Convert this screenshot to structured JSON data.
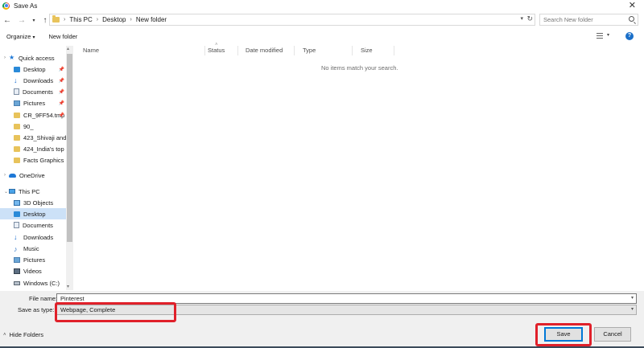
{
  "window": {
    "title": "Save As",
    "close_glyph": "✕"
  },
  "address_bar": {
    "crumbs": [
      "This PC",
      "Desktop",
      "New folder"
    ],
    "search_placeholder": "Search New folder"
  },
  "command_bar": {
    "organize": "Organize",
    "new_folder": "New folder"
  },
  "nav_pane": {
    "quick_access": "Quick access",
    "items": [
      {
        "label": "Quick access",
        "icon": "star-icon"
      },
      {
        "label": "Desktop",
        "icon": "desktop-icon",
        "pinned": true
      },
      {
        "label": "Downloads",
        "icon": "downloads-icon",
        "pinned": true
      },
      {
        "label": "Documents",
        "icon": "documents-icon",
        "pinned": true
      },
      {
        "label": "Pictures",
        "icon": "pictures-icon",
        "pinned": true
      },
      {
        "label": "CR_9FF54.tmp",
        "icon": "folder-icon",
        "pinned": true
      },
      {
        "label": "90_",
        "icon": "folder-icon"
      },
      {
        "label": "423_Shivaji and A",
        "icon": "folder-icon"
      },
      {
        "label": "424_India's top E",
        "icon": "folder-icon"
      },
      {
        "label": "Facts Graphics",
        "icon": "folder-icon"
      },
      {
        "label": "OneDrive",
        "icon": "onedrive-icon"
      },
      {
        "label": "This PC",
        "icon": "this-pc-icon"
      },
      {
        "label": "3D Objects",
        "icon": "3d-objects-icon"
      },
      {
        "label": "Desktop",
        "icon": "desktop-icon",
        "selected": true
      },
      {
        "label": "Documents",
        "icon": "documents-icon"
      },
      {
        "label": "Downloads",
        "icon": "downloads-icon"
      },
      {
        "label": "Music",
        "icon": "music-icon"
      },
      {
        "label": "Pictures",
        "icon": "pictures-icon"
      },
      {
        "label": "Videos",
        "icon": "videos-icon"
      },
      {
        "label": "Windows (C:)",
        "icon": "drive-icon"
      }
    ]
  },
  "file_list": {
    "columns": [
      "Name",
      "Status",
      "Date modified",
      "Type",
      "Size"
    ],
    "empty_message": "No items match your search."
  },
  "form": {
    "file_name_label": "File name:",
    "file_name_value": "Pinterest",
    "save_as_type_label": "Save as type:",
    "save_as_type_value": "Webpage, Complete",
    "hide_folders": "Hide Folders",
    "save": "Save",
    "cancel": "Cancel"
  },
  "colors": {
    "highlight": "#e0202a",
    "accent": "#0078d7",
    "selection": "#cce1f7"
  }
}
